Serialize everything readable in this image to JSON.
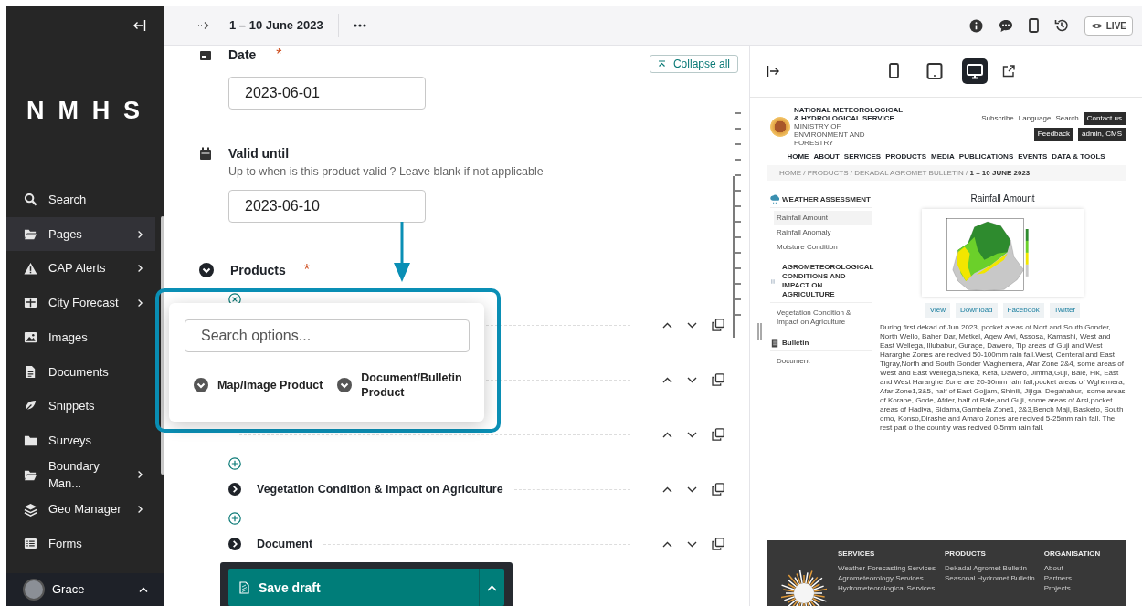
{
  "sidebar": {
    "logo": "NMHS",
    "items": [
      {
        "label": "Search",
        "has_submenu": false,
        "selected": false
      },
      {
        "label": "Pages",
        "has_submenu": true,
        "selected": true
      },
      {
        "label": "CAP Alerts",
        "has_submenu": true,
        "selected": false
      },
      {
        "label": "City Forecast",
        "has_submenu": true,
        "selected": false
      },
      {
        "label": "Images",
        "has_submenu": false,
        "selected": false
      },
      {
        "label": "Documents",
        "has_submenu": false,
        "selected": false
      },
      {
        "label": "Snippets",
        "has_submenu": false,
        "selected": false
      },
      {
        "label": "Surveys",
        "has_submenu": false,
        "selected": false
      },
      {
        "label": "Boundary Man...",
        "has_submenu": true,
        "selected": false
      },
      {
        "label": "Geo Manager",
        "has_submenu": true,
        "selected": false
      },
      {
        "label": "Forms",
        "has_submenu": false,
        "selected": false
      }
    ],
    "user": {
      "name": "Grace"
    }
  },
  "header": {
    "title": "1 – 10 June 2023",
    "live_label": "LIVE"
  },
  "form": {
    "collapse_all": "Collapse all",
    "fields": [
      {
        "label": "Date",
        "required_mark": "*",
        "value": "2023-06-01"
      },
      {
        "label": "Valid until",
        "help": "Up to when is this product valid ? Leave blank if not applicable",
        "value": "2023-06-10"
      }
    ],
    "products": {
      "label": "Products",
      "required_mark": "*",
      "expanded": true,
      "entries": [
        {
          "kind": "adder",
          "open": true
        },
        {
          "kind": "covered"
        },
        {
          "kind": "covered"
        },
        {
          "kind": "covered"
        },
        {
          "kind": "adder",
          "open": false
        },
        {
          "kind": "block",
          "label": "Vegetation Condition & Impact on Agriculture"
        },
        {
          "kind": "adder",
          "open": false
        },
        {
          "kind": "block",
          "label": "Document"
        }
      ]
    }
  },
  "chooser": {
    "placeholder": "Search options...",
    "options": [
      "Map/Image Product",
      "Document/Bulletin Product"
    ]
  },
  "save": {
    "label": "Save draft"
  },
  "preview": {
    "devices": [
      {
        "selected": false
      },
      {
        "selected": false
      },
      {
        "selected": true
      }
    ],
    "site": {
      "org_name": [
        "NATIONAL METEOROLOGICAL",
        "& HYDROLOGICAL SERVICE"
      ],
      "ministry": "MINISTRY OF ENVIRONMENT AND FORESTRY",
      "utility_links": [
        "Subscribe",
        "Language",
        "Search"
      ],
      "utility_buttons": [
        "Contact us",
        "Feedback",
        "admin, CMS"
      ],
      "nav": [
        "HOME",
        "ABOUT",
        "SERVICES",
        "PRODUCTS",
        "MEDIA",
        "PUBLICATIONS",
        "EVENTS",
        "DATA & TOOLS"
      ],
      "breadcrumb": "HOME / PRODUCTS / DEKADAL AGROMET BULLETIN / **1 – 10 JUNE 2023**",
      "sections": [
        {
          "title": "WEATHER ASSESSMENT",
          "items": [
            {
              "label": "Rainfall Amount",
              "selected": true
            },
            {
              "label": "Rainfall Anomaly",
              "selected": false
            },
            {
              "label": "Moisture Condition",
              "selected": false
            }
          ]
        },
        {
          "title": "AGROMETEOROLOGICAL CONDITIONS AND IMPACT ON AGRICULTURE",
          "items": [
            {
              "label": "Vegetation Condition & Impact on Agriculture",
              "selected": false
            }
          ]
        },
        {
          "title": "Bulletin",
          "items": [
            {
              "label": "Document",
              "selected": false
            }
          ]
        }
      ],
      "content_title": "Rainfall Amount",
      "actions": [
        "View",
        "Download",
        "Facebook",
        "Twitter"
      ],
      "description": "During first dekad of Jun 2023, pocket areas of Nort and South Gonder, North Wello, Baher Dar, Metkel, Agew Awi, Assosa, Kamashi, West and East Wellega, Illubabur, Gurage, Dawero, Tip areas of Guji and West Hararghe Zones are recived 50-100mm rain fall.West, Centeral and East Tigray,North and South Gonder Waghemera, Afar Zone 2&4, some areas of West and East Wellega,Sheka, Kefa, Dawero, Jimma,Guji, Bale, Fik, East and West Hararghe Zone are 20-50mm rain fall,pocket areas of Wghemera, Afar Zone1,3&5, half of East Gojjam, Shinili, Jijiga, Degahabur,, some areas of Korahe, Gode, Afder, half of Bale,and Guji, some areas of Arsi,pocket areas of Hadiya, Sidama,Gambela Zone1, 2&3,Bench Maji, Basketo, South omo, Konso,Dirashe and Amaro Zones are recived 5-25mm rain fall. The rest part o the country was recived 0-5mm rain fall.",
      "footer": [
        {
          "title": "SERVICES",
          "links": [
            "Weather Forecasting Services",
            "Agrometeorology Services",
            "Hydrometeorological Services"
          ]
        },
        {
          "title": "PRODUCTS",
          "links": [
            "Dekadal Agromet Bulletin",
            "Seasonal Hydromet Bulletin"
          ]
        },
        {
          "title": "ORGANISATION",
          "links": [
            "About",
            "Partners",
            "Projects"
          ]
        }
      ]
    }
  }
}
